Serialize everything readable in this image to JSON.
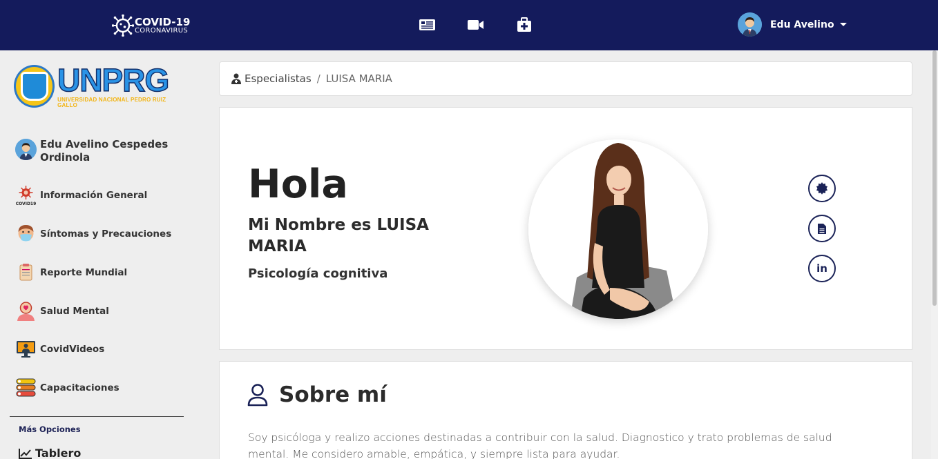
{
  "topbar": {
    "brand_title": "COVID-19",
    "brand_subtitle": "CORONAVIRUS",
    "nav_icons": [
      "news-icon",
      "video-icon",
      "first-aid-kit-icon"
    ],
    "user_name": "Edu Avelino"
  },
  "sidebar": {
    "logo_big": "UNPRG",
    "logo_small": "UNIVERSIDAD NACIONAL PEDRO RUIZ GALLO",
    "profile_name": "Edu Avelino Cespedes Ordinola",
    "items": [
      {
        "label": "Información General",
        "icon": "covid19-icon"
      },
      {
        "label": "Síntomas y Precauciones",
        "icon": "mask-person-icon"
      },
      {
        "label": "Reporte Mundial",
        "icon": "clipboard-report-icon"
      },
      {
        "label": "Salud Mental",
        "icon": "mental-health-icon"
      },
      {
        "label": "CovidVideos",
        "icon": "video-screen-icon"
      },
      {
        "label": "Capacitaciones",
        "icon": "training-list-icon"
      }
    ],
    "more_label": "Más Opciones",
    "tablero_label": "Tablero"
  },
  "breadcrumb": {
    "root": "Especialistas",
    "separator": "/",
    "current": "LUISA MARIA"
  },
  "profile_card": {
    "greeting": "Hola",
    "name_line": "Mi Nombre es LUISA MARIA",
    "specialty": "Psicología cognitiva",
    "social": [
      "badge-icon",
      "document-icon",
      "linkedin-icon"
    ],
    "linkedin_text": "in"
  },
  "about": {
    "title": "Sobre mí",
    "text": "Soy psicóloga y realizo acciones destinadas a contribuir con la salud. Diagnostico y trato problemas de salud mental. Me considero amable, empática, y siempre lista para ayudar."
  },
  "colors": {
    "topbar": "#141b5c",
    "accent": "#1a2257",
    "background": "#eeeeee"
  }
}
